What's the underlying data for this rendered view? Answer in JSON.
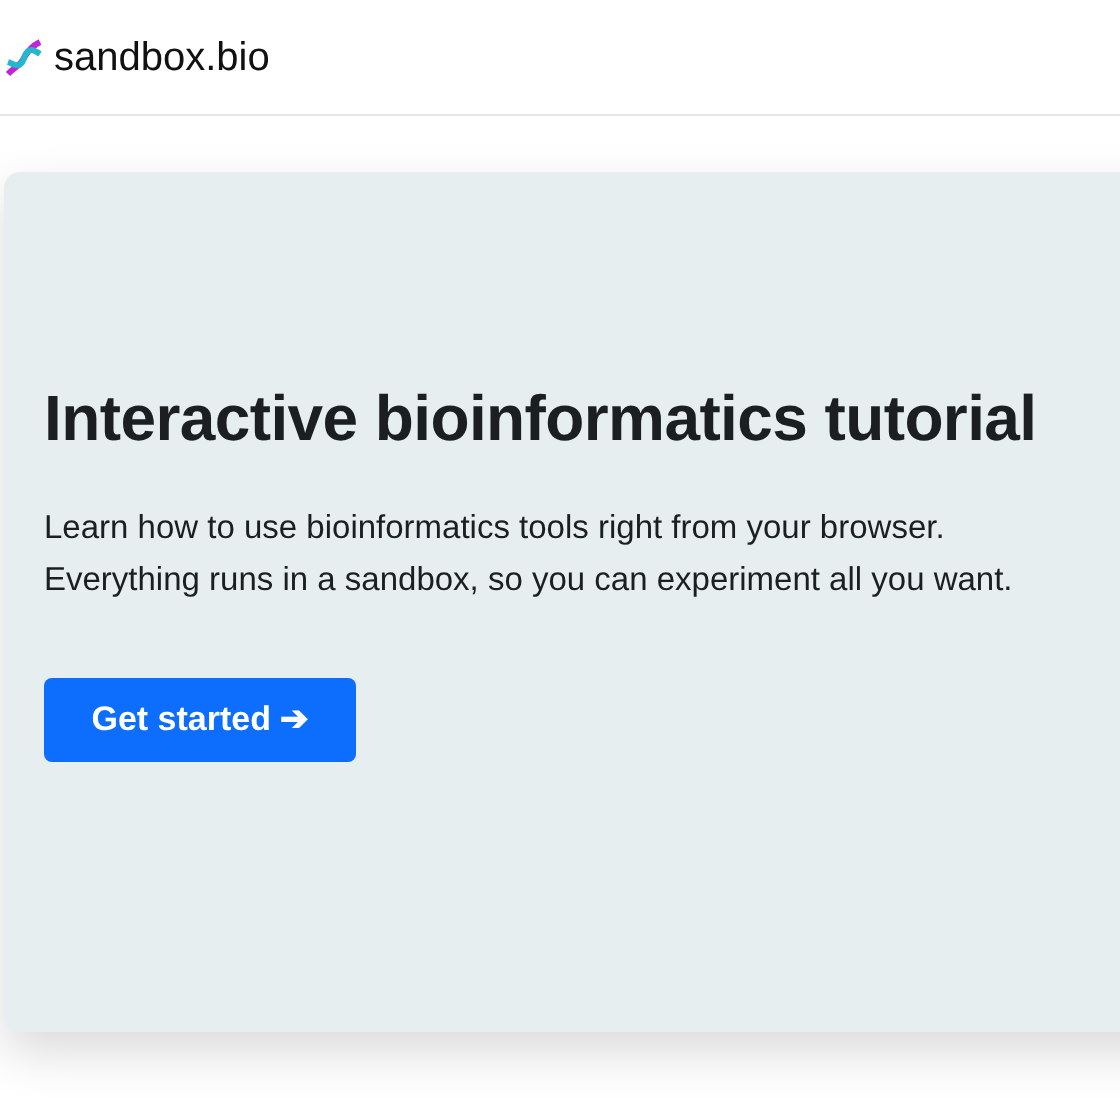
{
  "header": {
    "brand": "sandbox.bio"
  },
  "hero": {
    "title": "Interactive bioinformatics tutorial",
    "lines": [
      "Learn how to use bioinformatics tools right from your browser.",
      "Everything runs in a sandbox, so you can experiment all you want."
    ],
    "button": "Get started ➔"
  }
}
